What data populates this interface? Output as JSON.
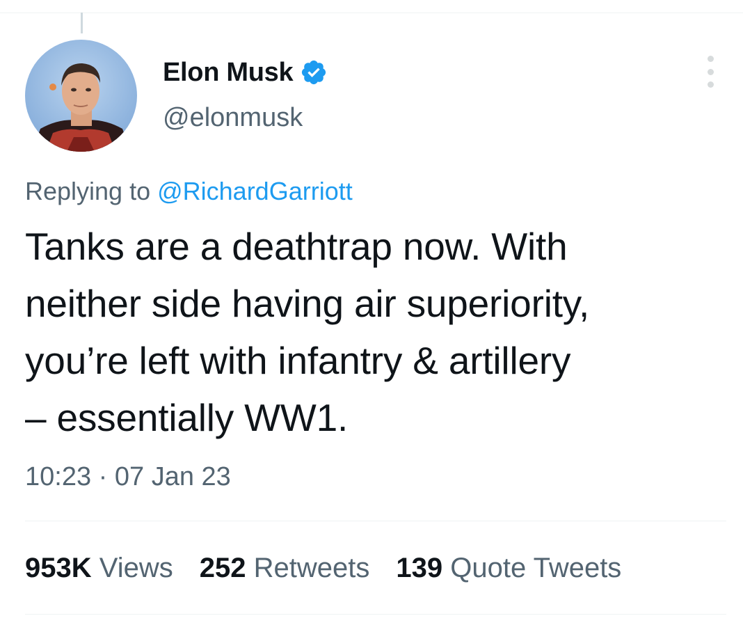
{
  "tweet": {
    "author": {
      "display_name": "Elon Musk",
      "handle": "@elonmusk",
      "verified": true
    },
    "reply": {
      "prefix": "Replying to ",
      "mention": "@RichardGarriott"
    },
    "text_lines": [
      "Tanks are a deathtrap now. With",
      "neither side having air superiority,",
      "you’re left with infantry & artillery",
      "– essentially WW1."
    ],
    "time": "10:23",
    "separator": " · ",
    "date": "07 Jan 23",
    "stats": {
      "views": {
        "count": "953K",
        "label": "Views"
      },
      "retweets": {
        "count": "252",
        "label": "Retweets"
      },
      "quotes": {
        "count": "139",
        "label": "Quote Tweets"
      }
    }
  },
  "icons": {
    "verified": "verified-badge-icon",
    "more": "more-vertical-icon"
  },
  "colors": {
    "accent": "#1d9bf0",
    "text_primary": "#0f1419",
    "text_secondary": "#536471",
    "divider": "#eff3f4"
  }
}
